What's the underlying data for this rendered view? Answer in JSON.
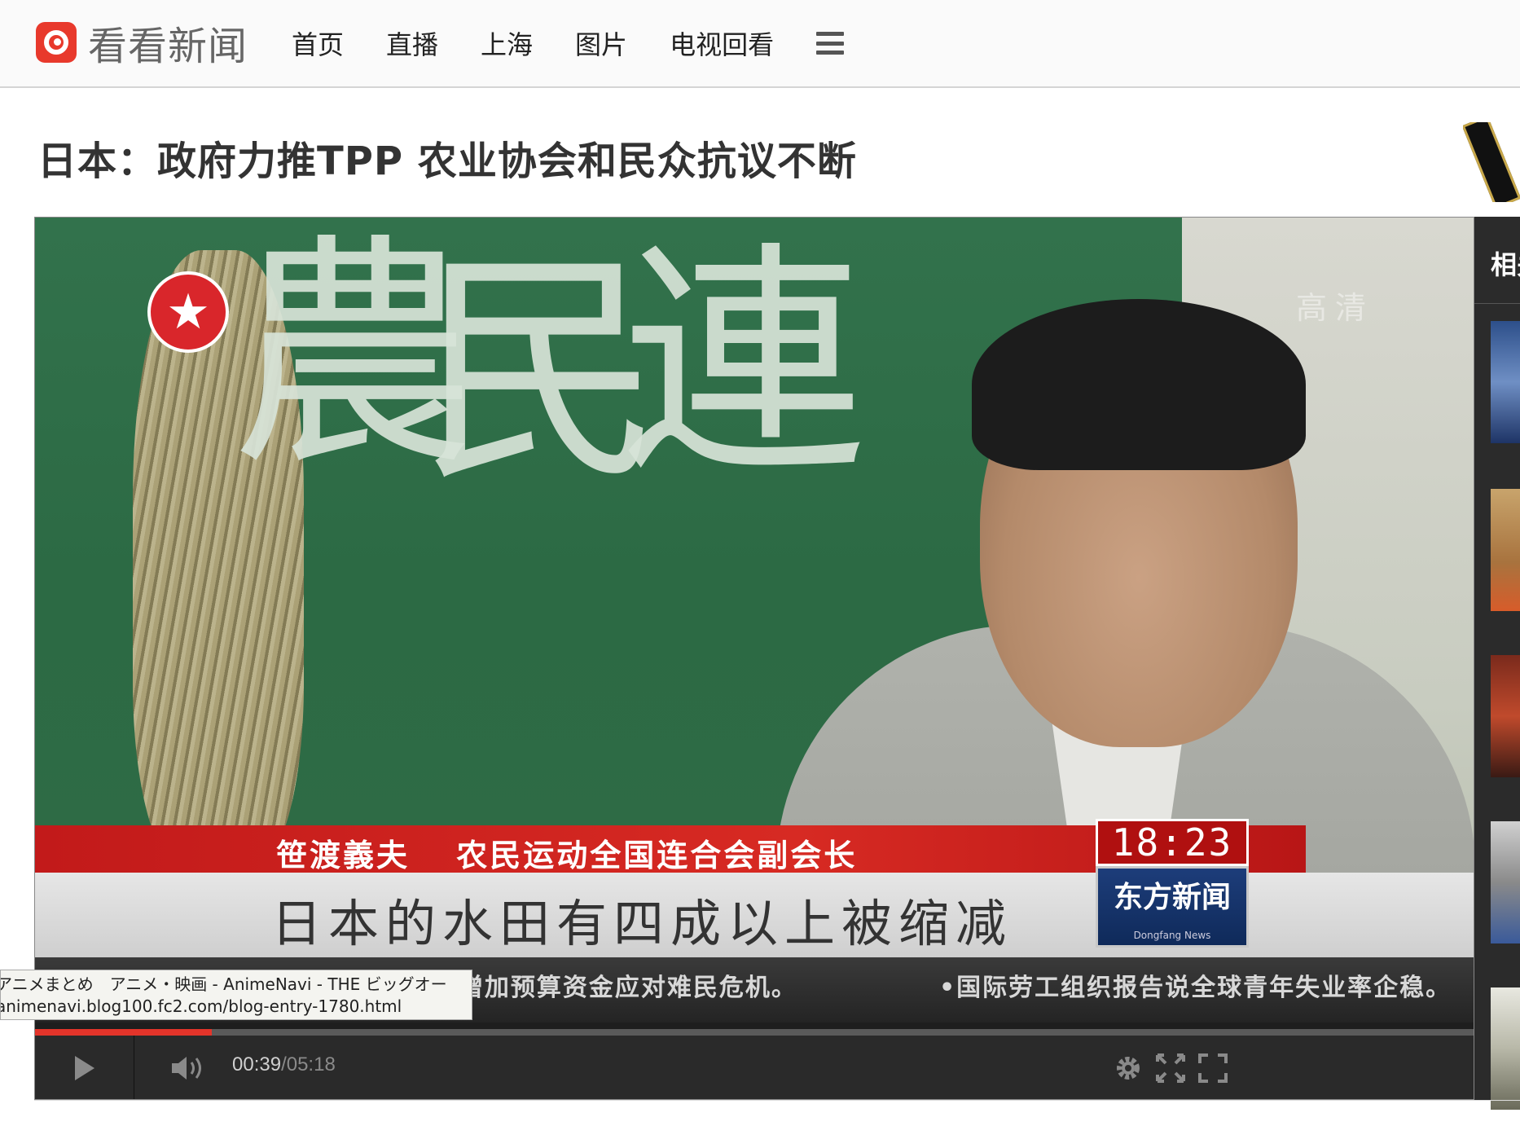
{
  "site": {
    "logo_text": "看看新闻"
  },
  "nav": {
    "items": [
      "首页",
      "直播",
      "上海",
      "图片",
      "电视回看"
    ]
  },
  "article": {
    "title": "日本：政府力推TPP 农业协会和民众抗议不断"
  },
  "video": {
    "banner_chars": [
      "農",
      "民",
      "連"
    ],
    "hd_mark": "高清",
    "lower_third_name": "笹渡義夫　 农民运动全国连合会副会长",
    "subtitle": "日本的水田有四成以上被缩减",
    "clock": "18:23",
    "brand": "东方新闻",
    "brand_sub": "Dongfang News",
    "ticker_left": "国际新闻 | 德国增加预算资金应对难民危机。",
    "ticker_right": "•国际劳工组织报告说全球青年失业率企稳。",
    "current_time": "00:39",
    "duration": "/05:18",
    "progress_fraction": 0.123
  },
  "tooltip": {
    "line1": "アニメまとめ　アニメ・映画 - AnimeNavi - THE ビッグオー",
    "line2": "animenavi.blog100.fc2.com/blog-entry-1780.html"
  },
  "sidebar": {
    "heading": "相关"
  },
  "colors": {
    "brand_red": "#e8392c",
    "progress_red": "#e3342a",
    "control_bar": "#2a2a2a"
  }
}
